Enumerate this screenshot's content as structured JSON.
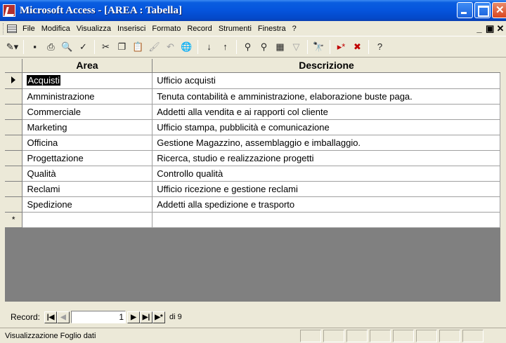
{
  "window": {
    "title": "Microsoft Access - [AREA : Tabella]"
  },
  "menu": {
    "items": [
      "File",
      "Modifica",
      "Visualizza",
      "Inserisci",
      "Formato",
      "Record",
      "Strumenti",
      "Finestra",
      "?"
    ]
  },
  "datasheet": {
    "columns": [
      "Area",
      "Descrizione"
    ],
    "rows": [
      {
        "area": "Acquisti",
        "descrizione": "Ufficio acquisti"
      },
      {
        "area": "Amministrazione",
        "descrizione": "Tenuta contabilità e amministrazione, elaborazione buste paga."
      },
      {
        "area": "Commerciale",
        "descrizione": "Addetti alla vendita e ai rapporti col cliente"
      },
      {
        "area": "Marketing",
        "descrizione": "Ufficio stampa, pubblicità e comunicazione"
      },
      {
        "area": "Officina",
        "descrizione": "Gestione Magazzino, assemblaggio e imballaggio."
      },
      {
        "area": "Progettazione",
        "descrizione": "Ricerca, studio e realizzazione progetti"
      },
      {
        "area": "Qualità",
        "descrizione": "Controllo qualità"
      },
      {
        "area": "Reclami",
        "descrizione": "Ufficio ricezione e gestione reclami"
      },
      {
        "area": "Spedizione",
        "descrizione": "Addetti alla spedizione e trasporto"
      }
    ],
    "new_row_marker": "*",
    "current_row_marker": "▶"
  },
  "record_nav": {
    "label": "Record:",
    "current": "1",
    "of_text": "di 9"
  },
  "status": {
    "text": "Visualizzazione Foglio dati"
  },
  "colors": {
    "titlebar": "#0554dc",
    "chrome": "#ece9d8",
    "grid_background": "#808080"
  }
}
